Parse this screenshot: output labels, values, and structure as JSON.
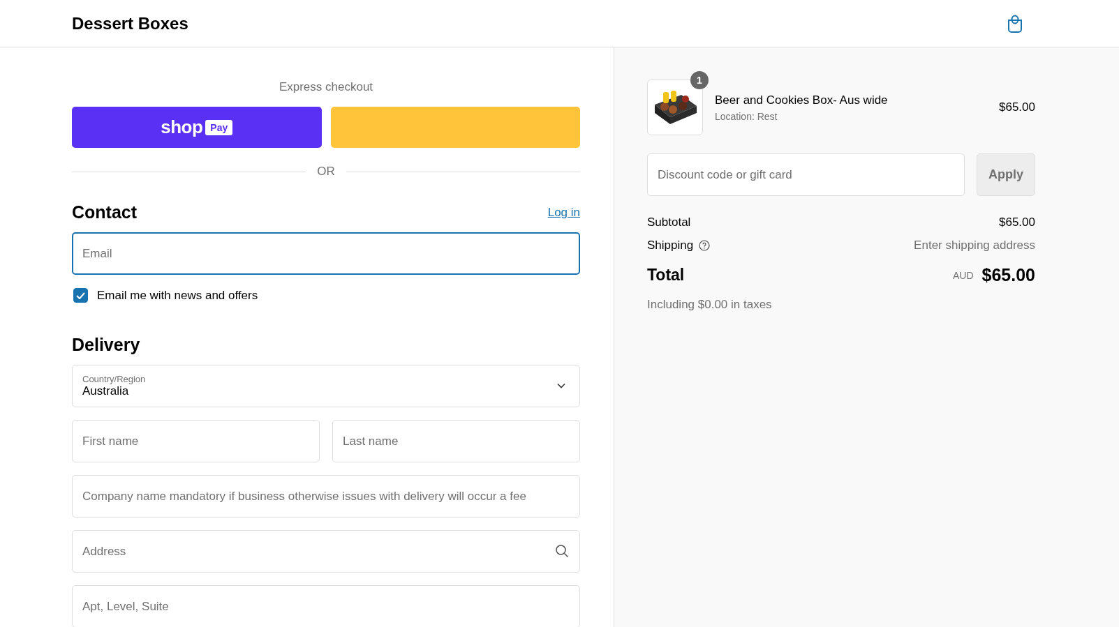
{
  "header": {
    "title": "Dessert Boxes"
  },
  "express_checkout": {
    "label": "Express checkout",
    "buttons": [
      {
        "kind": "shop_pay",
        "wordmark": "shop",
        "badge": "Pay"
      },
      {
        "kind": "paypal"
      }
    ],
    "divider": "OR"
  },
  "contact": {
    "heading": "Contact",
    "login_link": "Log in",
    "email": {
      "placeholder": "Email",
      "focused": true
    },
    "newsletter": {
      "label": "Email me with news and offers",
      "checked": true
    }
  },
  "delivery": {
    "heading": "Delivery",
    "fields": [
      {
        "kind": "select",
        "label": "Country/Region",
        "value": "Australia"
      },
      {
        "kind": "pair",
        "items": [
          {
            "placeholder": "First name"
          },
          {
            "placeholder": "Last name"
          }
        ]
      },
      {
        "kind": "text",
        "placeholder": "Company name mandatory if business otherwise issues with delivery will occur a fee"
      },
      {
        "kind": "search",
        "placeholder": "Address"
      },
      {
        "kind": "text",
        "placeholder": "Apt, Level, Suite"
      }
    ]
  },
  "summary": {
    "items": [
      {
        "name": "Beer and Cookies Box- Aus wide",
        "location": "Location: Rest",
        "price": "$65.00",
        "quantity": "1"
      }
    ],
    "discount": {
      "placeholder": "Discount code or gift card",
      "button": "Apply"
    },
    "subtotal": {
      "label": "Subtotal",
      "value": "$65.00"
    },
    "shipping": {
      "label": "Shipping",
      "value": "Enter shipping address"
    },
    "total": {
      "label": "Total",
      "currency": "AUD",
      "value": "$65.00"
    },
    "taxes_note": "Including $0.00 in taxes"
  }
}
